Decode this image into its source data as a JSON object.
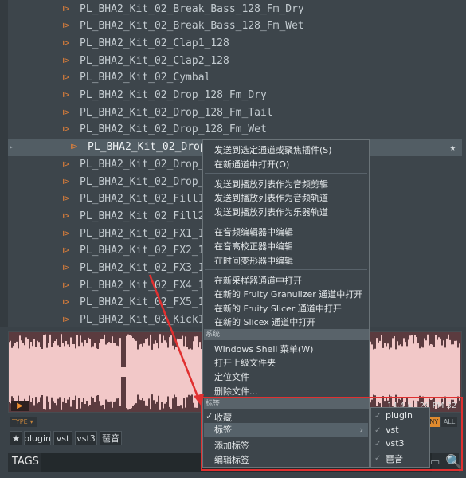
{
  "files": [
    "PL_BHA2_Kit_02_Break_Bass_128_Fm_Dry",
    "PL_BHA2_Kit_02_Break_Bass_128_Fm_Wet",
    "PL_BHA2_Kit_02_Clap1_128",
    "PL_BHA2_Kit_02_Clap2_128",
    "PL_BHA2_Kit_02_Cymbal",
    "PL_BHA2_Kit_02_Drop_128_Fm_Dry",
    "PL_BHA2_Kit_02_Drop_128_Fm_Tail",
    "PL_BHA2_Kit_02_Drop_128_Fm_Wet",
    "PL_BHA2_Kit_02_Drop_Ba",
    "PL_BHA2_Kit_02_Drop_Bass",
    "PL_BHA2_Kit_02_Drop_Perc",
    "PL_BHA2_Kit_02_Fill1_128",
    "PL_BHA2_Kit_02_Fill2_128",
    "PL_BHA2_Kit_02_FX1_128",
    "PL_BHA2_Kit_02_FX2_128",
    "PL_BHA2_Kit_02_FX3_128",
    "PL_BHA2_Kit_02_FX4_128",
    "PL_BHA2_Kit_02_FX5_128",
    "PL_BHA2_Kit_02_Kick1_128"
  ],
  "selected_index": 8,
  "menu": {
    "send_selected_channel": "发送到选定通道或聚焦插件(S)",
    "open_new_channel": "在新通道中打开(O)",
    "send_playlist_audio_clip": "发送到播放列表作为音频剪辑",
    "send_playlist_audio_track": "发送到播放列表作为音频轨道",
    "send_playlist_instrument_track": "发送到播放列表作为乐器轨道",
    "edit_audio_editor": "在音频编辑器中编辑",
    "edit_pitch_corrector": "在音高校正器中编辑",
    "edit_time_stretcher": "在时间变形器中编辑",
    "open_new_sampler": "在新采样器通道中打开",
    "open_granulizer": "在新的 Fruity Granulizer 通道中打开",
    "open_slicer": "在新的 Fruity Slicer 通道中打开",
    "open_slicex": "在新的 Slicex 通道中打开",
    "section_system": "系统",
    "shell_menu": "Windows Shell 菜单(W)",
    "open_parent": "打开上级文件夹",
    "locate_file": "定位文件",
    "delete_file": "删除文件...",
    "section_tags": "标签",
    "favorite": "收藏",
    "tags": "标签",
    "add_tag": "添加标签",
    "edit_tags": "编辑标签"
  },
  "submenu": [
    "plugin",
    "vst",
    "vst3",
    "琶音"
  ],
  "filter": {
    "type": "TYPE",
    "any": "ANY",
    "all": "ALL"
  },
  "chips": [
    "plugin",
    "vst",
    "vst3",
    "琶音"
  ],
  "tags_label": "TAGS",
  "wave_info": "14.4 k 128 PM 32",
  "colors": {
    "accent": "#f08a2a",
    "highlight_box": "#e03030",
    "waveform": "#f2c8c8"
  }
}
